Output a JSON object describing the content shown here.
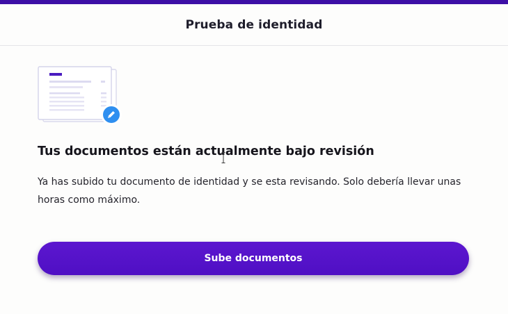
{
  "header": {
    "title": "Prueba de identidad"
  },
  "illustration": {
    "icon": "documents-under-review-icon",
    "badge_icon": "pencil-badge-icon"
  },
  "main": {
    "heading": "Tus documentos están actualmente bajo revisión",
    "description": "Ya has subido tu documento de identidad y se esta revisando. Solo debería llevar unas horas como máximo.",
    "cta_label": "Sube documentos"
  },
  "colors": {
    "brand": "#3d0fa6",
    "button": "#5214c8",
    "badge": "#2f8ff0"
  }
}
